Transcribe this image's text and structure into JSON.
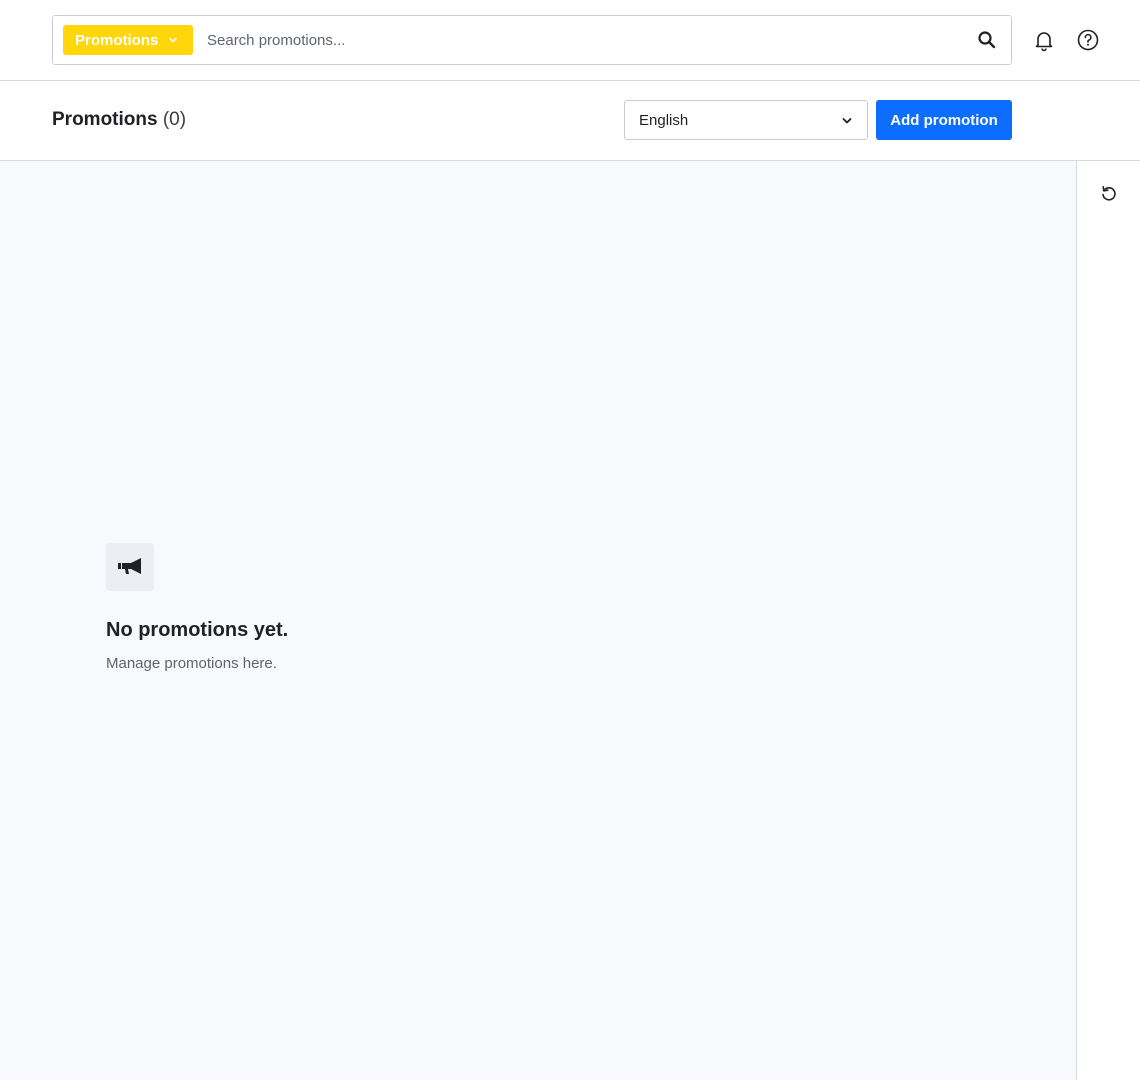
{
  "search": {
    "scope_label": "Promotions",
    "placeholder": "Search promotions..."
  },
  "header": {
    "title": "Promotions",
    "count": "(0)",
    "language": "English",
    "add_label": "Add promotion"
  },
  "empty_state": {
    "icon": "megaphone-icon",
    "title": "No promotions yet.",
    "subtitle": "Manage promotions here."
  },
  "icons": {
    "notifications": "bell-icon",
    "help": "help-icon",
    "search": "search-icon",
    "refresh": "refresh-icon"
  },
  "colors": {
    "scope_pill": "#ffd60a",
    "primary": "#0c6dff",
    "content_bg": "#f8f9fd"
  }
}
